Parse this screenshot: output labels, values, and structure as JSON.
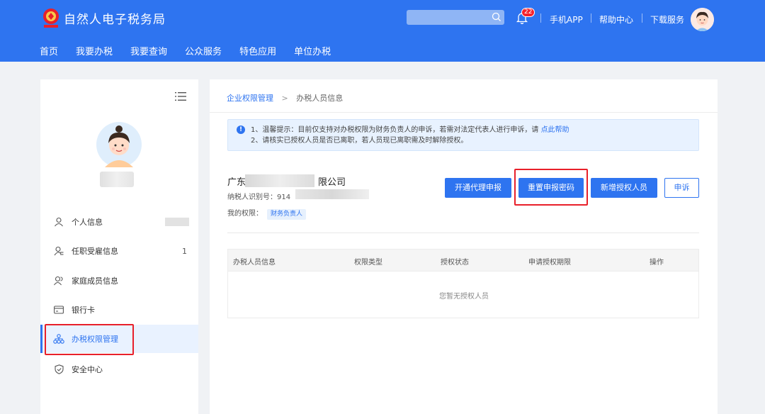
{
  "header": {
    "brand": "自然人电子税务局",
    "badge_count": "22",
    "links": [
      "手机APP",
      "帮助中心",
      "下载服务"
    ]
  },
  "nav": [
    "首页",
    "我要办税",
    "我要查询",
    "公众服务",
    "特色应用",
    "单位办税"
  ],
  "sidebar": {
    "items": [
      {
        "label": "个人信息",
        "value": ""
      },
      {
        "label": "任职受雇信息",
        "value": "1"
      },
      {
        "label": "家庭成员信息",
        "value": ""
      },
      {
        "label": "银行卡",
        "value": ""
      },
      {
        "label": "办税权限管理",
        "value": ""
      },
      {
        "label": "安全中心",
        "value": ""
      }
    ]
  },
  "breadcrumb": {
    "parent": "企业权限管理",
    "current": "办税人员信息"
  },
  "notice": {
    "line1_prefix": "1、温馨提示：目前仅支持对办税权限为财务负责人的申诉，若需对法定代表人进行申诉，请",
    "line1_link": "点此帮助",
    "line2": "2、请核实已授权人员是否已离职，若人员现已离职需及时解除授权。"
  },
  "company": {
    "name_prefix": "广东",
    "name_suffix": "限公司",
    "taxid_label": "纳税人识别号：914",
    "perm_label": "我的权限：",
    "perm_tag": "财务负责人"
  },
  "buttons": {
    "open_agent": "开通代理申报",
    "reset_password": "重置申报密码",
    "add_person": "新增授权人员",
    "appeal": "申诉"
  },
  "table": {
    "headers": [
      "办税人员信息",
      "权限类型",
      "授权状态",
      "申请授权期限",
      "操作"
    ],
    "empty": "您暂无授权人员"
  },
  "colors": {
    "primary": "#2e74f0",
    "highlight": "#e8202a"
  }
}
